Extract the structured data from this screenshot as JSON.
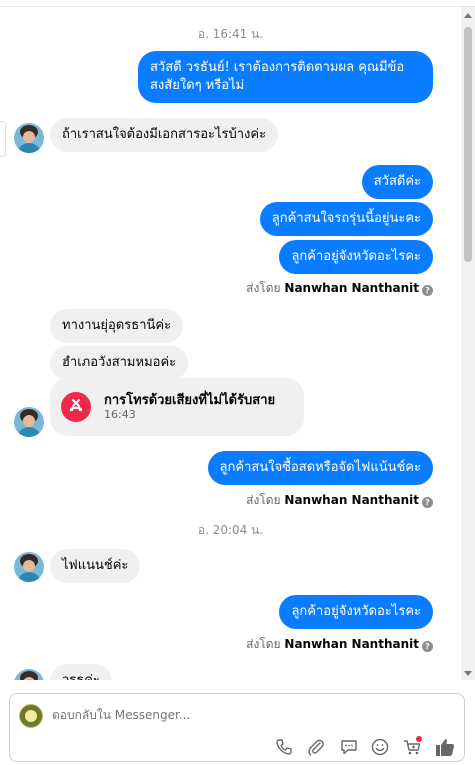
{
  "timestamps": [
    "อ. 16:41 น.",
    "อ. 20:04 น."
  ],
  "messages": {
    "m1": "สวัสดี วรธันย์! เราต้องการติดตามผล คุณมีข้อ",
    "m1b": "สงสัยใดๆ หรือไม่",
    "m2": "ถ้าเราสนใจต้องมีเอกสารอะไรบ้างค่ะ",
    "m3": "สวัสดีค่ะ",
    "m4": "ลูกค้าสนใจรถรุ่นนี้อยู่นะคะ",
    "m5": "ลูกค้าอยู่จังหวัดอะไรคะ",
    "m6": "ทางานยุ่อุดรธานีค่ะ",
    "m7": "ฮำเภอวังสามหมอค่ะ",
    "m8": "ลูกค้าสนใจซื้อสดหรือจัดไฟแน้นช์คะ",
    "m9": "ไฟแนนช์ค่ะ",
    "m10": "ลูกค้าอยู่จังหวัดอะไรคะ",
    "m11": "วรธค่ะ"
  },
  "sent_by": {
    "prefix": "ส่งโดย",
    "name": "Nanwhan Nanthanit"
  },
  "missed_call": {
    "title": "การโทรด้วยเสียงที่ไม่ได้รับสาย",
    "time": "16:43"
  },
  "composer": {
    "placeholder": "ตอบกลับใน Messenger..."
  },
  "colors": {
    "outgoing": "#0a7cff",
    "incoming": "#f0f0f0",
    "missed_call": "#f02849",
    "accent": "#0a7cff"
  },
  "icons": [
    "phone-icon",
    "paperclip-icon",
    "chat-icon",
    "emoji-icon",
    "cart-icon",
    "thumbs-up-icon",
    "missed-call-icon",
    "info-icon"
  ]
}
